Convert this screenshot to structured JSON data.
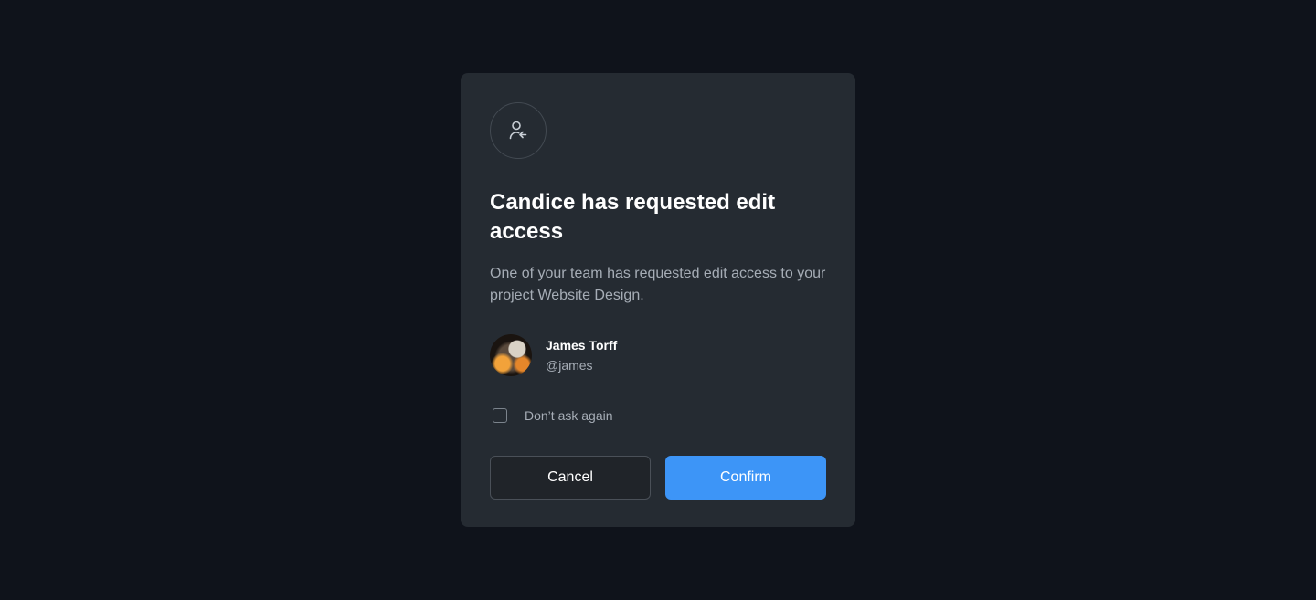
{
  "modal": {
    "icon": "user-request-icon",
    "title": "Candice has requested edit access",
    "description": "One of your team has requested edit access to your project Website Design.",
    "user": {
      "name": "James Torff",
      "handle": "@james"
    },
    "checkbox_label": "Don’t ask again",
    "checkbox_checked": false,
    "cancel_label": "Cancel",
    "confirm_label": "Confirm"
  },
  "colors": {
    "background": "#0f131b",
    "modal": "#252b32",
    "primary": "#3d95f7",
    "text_muted": "#a6adb6"
  }
}
